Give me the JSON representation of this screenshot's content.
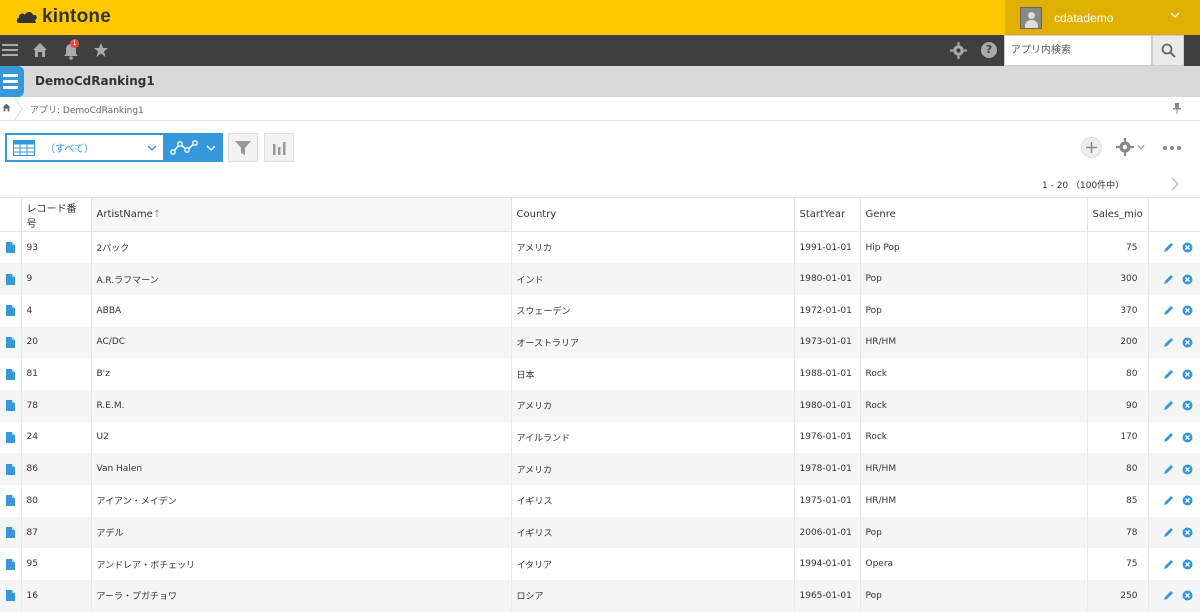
{
  "header": {
    "logo_text": "kintone",
    "user_name": "cdatademo"
  },
  "nav": {
    "notification_count": "1",
    "search_placeholder": "アプリ内検索"
  },
  "app": {
    "title": "DemoCdRanking1"
  },
  "breadcrumb": {
    "text": "アプリ: DemoCdRanking1"
  },
  "toolbar": {
    "view_selected": "（すべて）",
    "pager": "1 - 20 （100件中）"
  },
  "table": {
    "columns": [
      {
        "label": "レコード番号"
      },
      {
        "label": "ArtistName",
        "sort": "↑"
      },
      {
        "label": "Country"
      },
      {
        "label": "StartYear"
      },
      {
        "label": "Genre"
      },
      {
        "label": "Sales_mio"
      }
    ],
    "rows": [
      {
        "id": "93",
        "artist": "2パック",
        "country": "アメリカ",
        "start": "1991-01-01",
        "genre": "Hip Pop",
        "sales": "75"
      },
      {
        "id": "9",
        "artist": "A.R.ラフマーン",
        "country": "インド",
        "start": "1980-01-01",
        "genre": "Pop",
        "sales": "300"
      },
      {
        "id": "4",
        "artist": "ABBA",
        "country": "スウェーデン",
        "start": "1972-01-01",
        "genre": "Pop",
        "sales": "370"
      },
      {
        "id": "20",
        "artist": "AC/DC",
        "country": "オーストラリア",
        "start": "1973-01-01",
        "genre": "HR/HM",
        "sales": "200"
      },
      {
        "id": "81",
        "artist": "B'z",
        "country": "日本",
        "start": "1988-01-01",
        "genre": "Rock",
        "sales": "80"
      },
      {
        "id": "78",
        "artist": "R.E.M.",
        "country": "アメリカ",
        "start": "1980-01-01",
        "genre": "Rock",
        "sales": "90"
      },
      {
        "id": "24",
        "artist": "U2",
        "country": "アイルランド",
        "start": "1976-01-01",
        "genre": "Rock",
        "sales": "170"
      },
      {
        "id": "86",
        "artist": "Van Halen",
        "country": "アメリカ",
        "start": "1978-01-01",
        "genre": "HR/HM",
        "sales": "80"
      },
      {
        "id": "80",
        "artist": "アイアン・メイデン",
        "country": "イギリス",
        "start": "1975-01-01",
        "genre": "HR/HM",
        "sales": "85"
      },
      {
        "id": "87",
        "artist": "アデル",
        "country": "イギリス",
        "start": "2006-01-01",
        "genre": "Pop",
        "sales": "78"
      },
      {
        "id": "95",
        "artist": "アンドレア・ボチェッリ",
        "country": "イタリア",
        "start": "1994-01-01",
        "genre": "Opera",
        "sales": "75"
      },
      {
        "id": "16",
        "artist": "アーラ・プガチョワ",
        "country": "ロシア",
        "start": "1965-01-01",
        "genre": "Pop",
        "sales": "250"
      }
    ]
  },
  "icons": {
    "row_doc": "document-icon",
    "row_edit": "pencil-icon",
    "row_delete": "delete-icon"
  },
  "colors": {
    "brand_yellow": "#ffc800",
    "accent_blue": "#3498db",
    "nav_dark": "#3f3f3f"
  }
}
